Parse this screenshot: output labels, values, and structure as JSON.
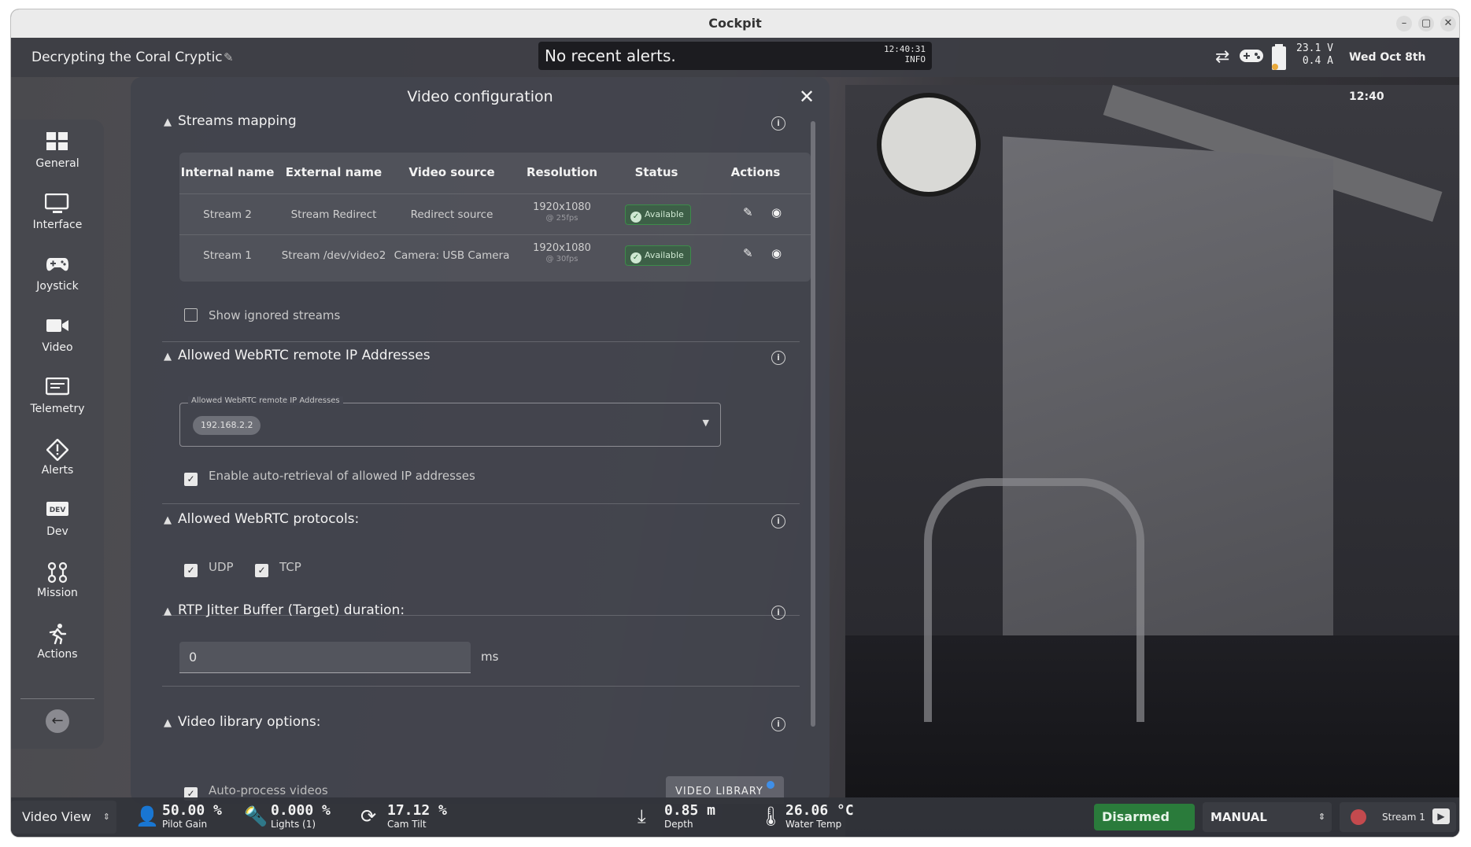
{
  "window": {
    "title": "Cockpit",
    "controls": [
      "–",
      "▢",
      "✕"
    ]
  },
  "topbar": {
    "mission_name": "Decrypting the Coral Cryptic",
    "alert_message": "No recent alerts.",
    "alert_time": "12:40:31",
    "alert_level": "INFO",
    "voltage": "23.1 V",
    "current": "0.4 A",
    "datetime": "Wed Oct 8th 12:40"
  },
  "sidebar": {
    "items": [
      {
        "label": "General",
        "icon": "grid-icon"
      },
      {
        "label": "Interface",
        "icon": "monitor-icon"
      },
      {
        "label": "Joystick",
        "icon": "gamepad-icon"
      },
      {
        "label": "Video",
        "icon": "video-camera-icon"
      },
      {
        "label": "Telemetry",
        "icon": "telemetry-icon"
      },
      {
        "label": "Alerts",
        "icon": "alert-diamond-icon"
      },
      {
        "label": "Dev",
        "icon": "dev-icon"
      },
      {
        "label": "Mission",
        "icon": "mission-route-icon"
      },
      {
        "label": "Actions",
        "icon": "running-person-icon"
      }
    ]
  },
  "dialog": {
    "title": "Video configuration",
    "streams": {
      "title": "Streams mapping",
      "columns": [
        "Internal name",
        "External name",
        "Video source",
        "Resolution",
        "Status",
        "Actions"
      ],
      "rows": [
        {
          "internal": "Stream 2",
          "external": "Stream Redirect",
          "source": "Redirect source",
          "resolution": "1920x1080",
          "fps": "@ 25fps",
          "status": "Available"
        },
        {
          "internal": "Stream 1",
          "external": "Stream /dev/video2",
          "source": "Camera: USB Camera",
          "resolution": "1920x1080",
          "fps": "@ 30fps",
          "status": "Available"
        }
      ],
      "show_ignored_label": "Show ignored streams"
    },
    "webrtc_ips": {
      "title": "Allowed WebRTC remote IP Addresses",
      "field_label": "Allowed WebRTC remote IP Addresses",
      "chip": "192.168.2.2",
      "auto_retrieval_label": "Enable auto-retrieval of allowed IP addresses"
    },
    "protocols": {
      "title": "Allowed WebRTC protocols:",
      "udp": "UDP",
      "tcp": "TCP"
    },
    "jitter": {
      "title": "RTP Jitter Buffer (Target) duration:",
      "value": "0",
      "unit": "ms"
    },
    "library": {
      "title": "Video library options:",
      "auto_process_label": "Auto-process videos",
      "button_label": "VIDEO LIBRARY"
    }
  },
  "bottombar": {
    "view": "Video View",
    "pilot_gain_value": "50.00 %",
    "pilot_gain_label": "Pilot Gain",
    "lights_value": "0.000 %",
    "lights_label": "Lights (1)",
    "cam_tilt_value": "17.12 %",
    "cam_tilt_label": "Cam Tilt",
    "depth_value": "0.85 m",
    "depth_label": "Depth",
    "water_temp_value": "26.06 °C",
    "water_temp_label": "Water Temp",
    "arm_state": "Disarmed",
    "flight_mode": "MANUAL",
    "record_stream": "Stream 1"
  }
}
